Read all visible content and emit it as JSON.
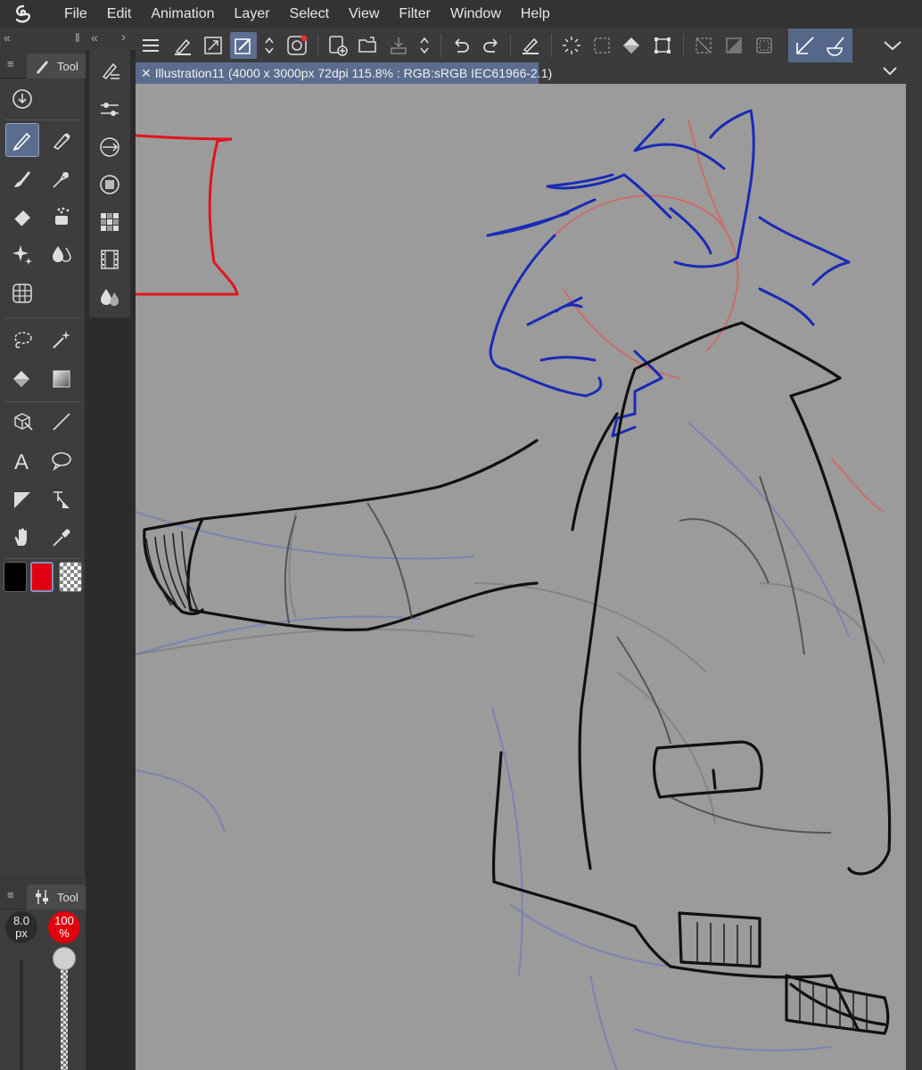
{
  "app": {
    "logo_icon": "clip-studio-logo-icon"
  },
  "menu": [
    "File",
    "Edit",
    "Animation",
    "Layer",
    "Select",
    "View",
    "Filter",
    "Window",
    "Help"
  ],
  "tool_panel": {
    "tab_label": "Tool"
  },
  "property_panel": {
    "tab_label": "Tool",
    "brush_size_value": "8.0",
    "brush_size_unit": "px",
    "opacity_value": "100",
    "opacity_unit": "%"
  },
  "document": {
    "title": "Illustration11 (4000 x 3000px 72dpi 115.8% : RGB:sRGB IEC61966-2.1)"
  },
  "colors": {
    "main_color": "#000000",
    "sub_color": "#e0000f",
    "accent": "#5a6d8e",
    "canvas_bg": "#9b9b9b"
  }
}
